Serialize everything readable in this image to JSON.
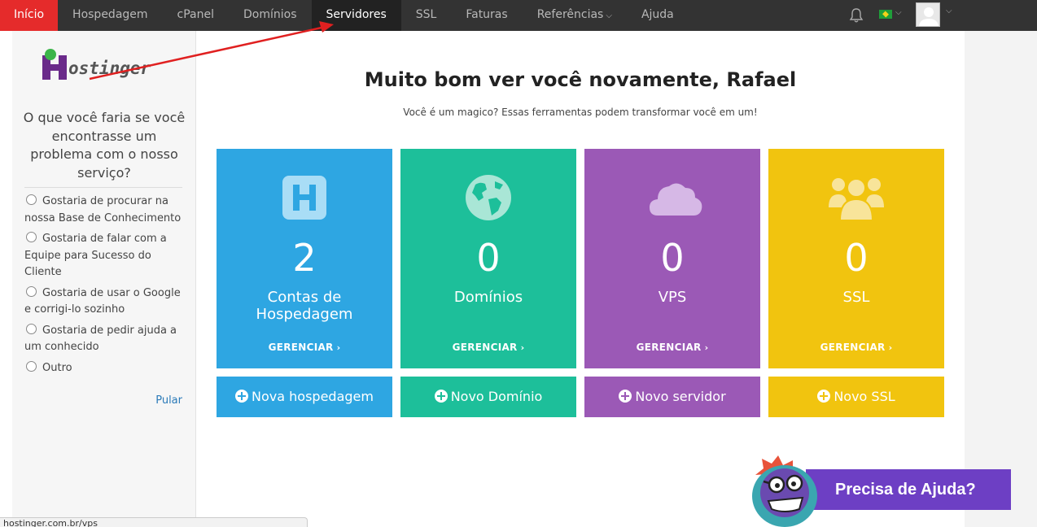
{
  "nav": {
    "items": [
      {
        "label": "Início"
      },
      {
        "label": "Hospedagem"
      },
      {
        "label": "cPanel"
      },
      {
        "label": "Domínios"
      },
      {
        "label": "Servidores"
      },
      {
        "label": "SSL"
      },
      {
        "label": "Faturas"
      },
      {
        "label": "Referências"
      },
      {
        "label": "Ajuda"
      }
    ],
    "active_index": 0,
    "current_index": 4
  },
  "sidebar": {
    "logo_text": "Hostinger",
    "question": "O que você faria se você encontrasse um problema com o nosso serviço?",
    "options": [
      {
        "label": "Gostaria de procurar na nossa Base de Conhecimento"
      },
      {
        "label": "Gostaria de falar com a Equipe para Sucesso do Cliente"
      },
      {
        "label": "Gostaria de usar o Google e corrigi-lo sozinho"
      },
      {
        "label": "Gostaria de pedir ajuda a um conhecido"
      },
      {
        "label": "Outro"
      }
    ],
    "skip_label": "Pular"
  },
  "main": {
    "heading": "Muito bom ver você novamente, Rafael",
    "subheading": "Você é um magico? Essas ferramentas podem transformar você em um!",
    "cards": [
      {
        "icon": "hosting-icon",
        "count": "2",
        "label_line1": "Contas de",
        "label_line2": "Hospedagem",
        "manage": "GERENCIAR",
        "color": "#2ea6e2",
        "button": "Nova hospedagem"
      },
      {
        "icon": "globe-icon",
        "count": "0",
        "label_line1": "Domínios",
        "label_line2": "",
        "manage": "GERENCIAR",
        "color": "#1dbf9a",
        "button": "Novo Domínio"
      },
      {
        "icon": "cloud-icon",
        "count": "0",
        "label_line1": "VPS",
        "label_line2": "",
        "manage": "GERENCIAR",
        "color": "#9b59b6",
        "button": "Novo servidor"
      },
      {
        "icon": "users-icon",
        "count": "0",
        "label_line1": "SSL",
        "label_line2": "",
        "manage": "GERENCIAR",
        "color": "#f1c40f",
        "button": "Novo SSL"
      }
    ]
  },
  "help": {
    "label": "Precisa de Ajuda?"
  },
  "statusbar": {
    "url": "hostinger.com.br/vps"
  },
  "colors": {
    "accent_red": "#e52b2b",
    "nav_bg": "#333333",
    "help_purple": "#6d3fc4"
  }
}
